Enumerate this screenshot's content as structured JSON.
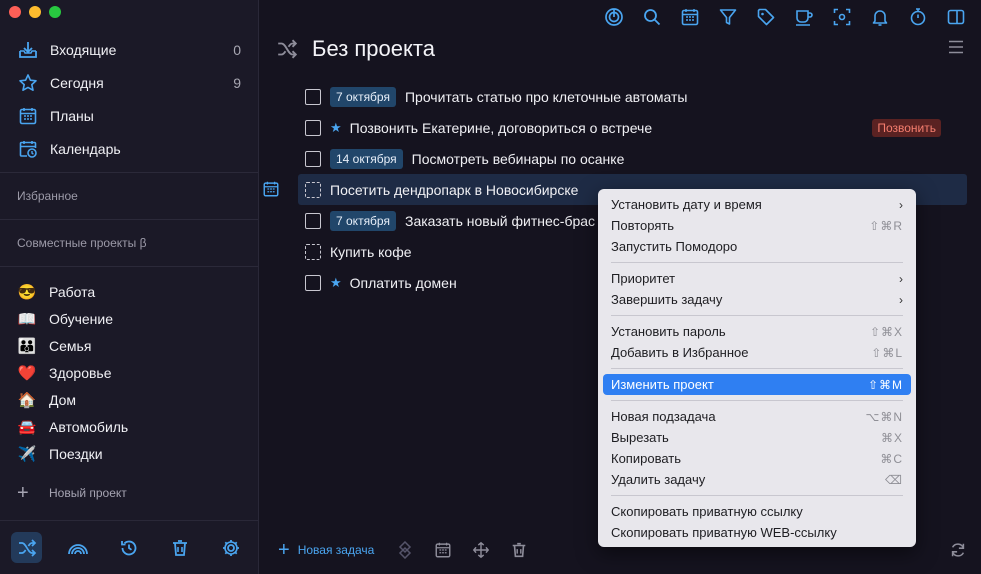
{
  "sidebar": {
    "nav": [
      {
        "label": "Входящие",
        "count": "0",
        "icon": "inbox-icon"
      },
      {
        "label": "Сегодня",
        "count": "9",
        "icon": "star-icon"
      },
      {
        "label": "Планы",
        "count": "",
        "icon": "plans-calendar-icon"
      },
      {
        "label": "Календарь",
        "count": "",
        "icon": "calendar-clock-icon"
      }
    ],
    "favorites_title": "Избранное",
    "shared_title": "Совместные проекты β",
    "projects": [
      {
        "emoji": "😎",
        "label": "Работа"
      },
      {
        "emoji": "📖",
        "label": "Обучение"
      },
      {
        "emoji": "👪",
        "label": "Семья"
      },
      {
        "emoji": "❤️",
        "label": "Здоровье"
      },
      {
        "emoji": "🏠",
        "label": "Дом"
      },
      {
        "emoji": "🚘",
        "label": "Автомобиль"
      },
      {
        "emoji": "✈️",
        "label": "Поездки"
      }
    ],
    "new_project": "Новый проект",
    "accent": "#4aa5f0"
  },
  "main": {
    "title": "Без проекта",
    "tasks": [
      {
        "date": "7 октября",
        "star": false,
        "text": "Прочитать статью про клеточные автоматы",
        "tag": "",
        "dashed": false,
        "selected": false
      },
      {
        "date": "",
        "star": true,
        "text": "Позвонить Екатерине, договориться о встрече",
        "tag": "Позвонить",
        "dashed": false,
        "selected": false
      },
      {
        "date": "14 октября",
        "star": false,
        "text": "Посмотреть вебинары по осанке",
        "tag": "",
        "dashed": false,
        "selected": false
      },
      {
        "date": "",
        "star": false,
        "text": "Посетить дендропарк в Новосибирске",
        "tag": "",
        "dashed": true,
        "selected": true
      },
      {
        "date": "7 октября",
        "star": false,
        "text": "Заказать новый фитнес-брас",
        "tag": "",
        "dashed": false,
        "selected": false
      },
      {
        "date": "",
        "star": false,
        "text": "Купить кофе",
        "tag": "",
        "dashed": true,
        "selected": false
      },
      {
        "date": "",
        "star": true,
        "text": "Оплатить домен",
        "tag": "",
        "dashed": false,
        "selected": false
      }
    ],
    "new_task": "Новая задача",
    "star_glyph": "★"
  },
  "context_menu": {
    "groups": [
      [
        {
          "label": "Установить дату и время",
          "shortcut": "",
          "submenu": true
        },
        {
          "label": "Повторять",
          "shortcut": "⇧⌘R",
          "submenu": false
        },
        {
          "label": "Запустить Помодоро",
          "shortcut": "",
          "submenu": false
        }
      ],
      [
        {
          "label": "Приоритет",
          "shortcut": "",
          "submenu": true
        },
        {
          "label": "Завершить задачу",
          "shortcut": "",
          "submenu": true
        }
      ],
      [
        {
          "label": "Установить пароль",
          "shortcut": "⇧⌘X",
          "submenu": false
        },
        {
          "label": "Добавить в Избранное",
          "shortcut": "⇧⌘L",
          "submenu": false
        }
      ],
      [
        {
          "label": "Изменить проект",
          "shortcut": "⇧⌘M",
          "submenu": false,
          "highlighted": true
        }
      ],
      [
        {
          "label": "Новая подзадача",
          "shortcut": "⌥⌘N",
          "submenu": false
        },
        {
          "label": "Вырезать",
          "shortcut": "⌘X",
          "submenu": false
        },
        {
          "label": "Копировать",
          "shortcut": "⌘C",
          "submenu": false
        },
        {
          "label": "Удалить задачу",
          "shortcut": "⌫",
          "submenu": false
        }
      ],
      [
        {
          "label": "Скопировать приватную ссылку",
          "shortcut": "",
          "submenu": false
        },
        {
          "label": "Скопировать приватную WEB-ссылку",
          "shortcut": "",
          "submenu": false
        }
      ]
    ],
    "submenu_glyph": "›"
  }
}
